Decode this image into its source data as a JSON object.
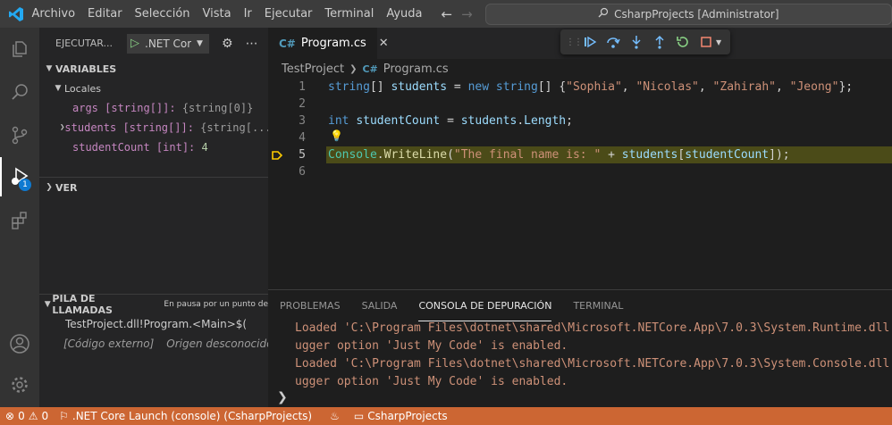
{
  "window": {
    "command_center": "CsharpProjects [Administrator]"
  },
  "menu": [
    "Archivo",
    "Editar",
    "Selección",
    "Vista",
    "Ir",
    "Ejecutar",
    "Terminal",
    "Ayuda"
  ],
  "activity": {
    "debug_badge": "1"
  },
  "sidebar": {
    "title": "EJECUTAR...",
    "launch_config": ".NET Core Launch (console)",
    "variables_title": "VARIABLES",
    "locals_label": "Locales",
    "variables": [
      {
        "name": "args [string[]]:",
        "value": "{string[0]}"
      },
      {
        "name": "students [string[]]:",
        "value": "{string[..."
      },
      {
        "name": "studentCount [int]:",
        "value": "4"
      }
    ],
    "watch_title": "VER",
    "callstack_title": "PILA DE LLAMADAS",
    "callstack_status": "En pausa por un punto de",
    "frames": [
      {
        "name": "TestProject.dll!Program.<Main>$(",
        "source": ""
      },
      {
        "name": "[Código externo]",
        "source": "Origen desconocido"
      }
    ]
  },
  "editor": {
    "tab_label": "Program.cs",
    "breadcrumb": [
      "TestProject",
      "Program.cs"
    ],
    "line_numbers": [
      "1",
      "2",
      "3",
      "4",
      "5",
      "6"
    ],
    "code": {
      "l1": {
        "type": "string",
        "brackets1": "[]",
        "var": "students",
        "eq": "=",
        "new": "new",
        "type2": "string",
        "brackets2": "[]",
        "open": "{",
        "s1": "\"Sophia\"",
        "s2": "\"Nicolas\"",
        "s3": "\"Zahirah\"",
        "s4": "\"Jeong\"",
        "comma": ",",
        "close": "};"
      },
      "l3": {
        "type": "int",
        "var": "studentCount",
        "eq": "=",
        "obj": "students",
        "dot": ".",
        "prop": "Length",
        "end": ";"
      },
      "l5": {
        "cls": "Console",
        "dot": ".",
        "fn": "WriteLine",
        "open": "(",
        "str": "\"The final name is: \"",
        "plus": "+",
        "arr": "students",
        "lb": "[",
        "idx": "studentCount",
        "rb": "]",
        "close": ");"
      }
    }
  },
  "panel": {
    "tabs": [
      "PROBLEMAS",
      "SALIDA",
      "CONSOLA DE DEPURACIÓN",
      "TERMINAL"
    ],
    "active_tab": "CONSOLA DE DEPURACIÓN",
    "output": [
      "Loaded 'C:\\Program Files\\dotnet\\shared\\Microsoft.NETCore.App\\7.0.3\\System.Runtime.dll'.",
      "ugger option 'Just My Code' is enabled.",
      "Loaded 'C:\\Program Files\\dotnet\\shared\\Microsoft.NETCore.App\\7.0.3\\System.Console.dll'.",
      "ugger option 'Just My Code' is enabled."
    ],
    "prompt": "❯"
  },
  "statusbar": {
    "errors": "0",
    "warnings": "0",
    "launch": ".NET Core Launch (console) (CsharpProjects)",
    "folder": "CsharpProjects"
  },
  "colors": {
    "statusbar": "#cc6633",
    "current_line": "#4b4b18",
    "accent": "#0e7ad1"
  }
}
